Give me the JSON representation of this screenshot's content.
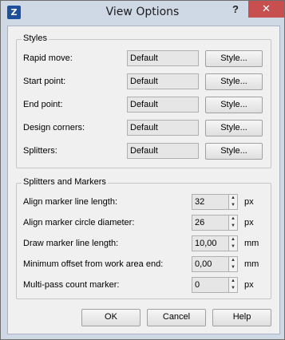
{
  "window": {
    "title": "View Options",
    "app_icon_glyph": "Z",
    "help_glyph": "?",
    "close_glyph": "✕"
  },
  "styles": {
    "label": "Styles",
    "rows": [
      {
        "label": "Rapid move:",
        "value": "Default",
        "button": "Style..."
      },
      {
        "label": "Start point:",
        "value": "Default",
        "button": "Style..."
      },
      {
        "label": "End point:",
        "value": "Default",
        "button": "Style..."
      },
      {
        "label": "Design corners:",
        "value": "Default",
        "button": "Style..."
      },
      {
        "label": "Splitters:",
        "value": "Default",
        "button": "Style..."
      }
    ]
  },
  "markers": {
    "label": "Splitters and Markers",
    "rows": [
      {
        "label": "Align marker line length:",
        "value": "32",
        "unit": "px"
      },
      {
        "label": "Align marker circle diameter:",
        "value": "26",
        "unit": "px"
      },
      {
        "label": "Draw marker line length:",
        "value": "10,00",
        "unit": "mm"
      },
      {
        "label": "Minimum offset from work area end:",
        "value": "0,00",
        "unit": "mm"
      },
      {
        "label": "Multi-pass count marker:",
        "value": "0",
        "unit": "px"
      }
    ]
  },
  "footer": {
    "ok": "OK",
    "cancel": "Cancel",
    "help": "Help"
  },
  "icons": {
    "spin_up": "▲",
    "spin_down": "▼"
  }
}
